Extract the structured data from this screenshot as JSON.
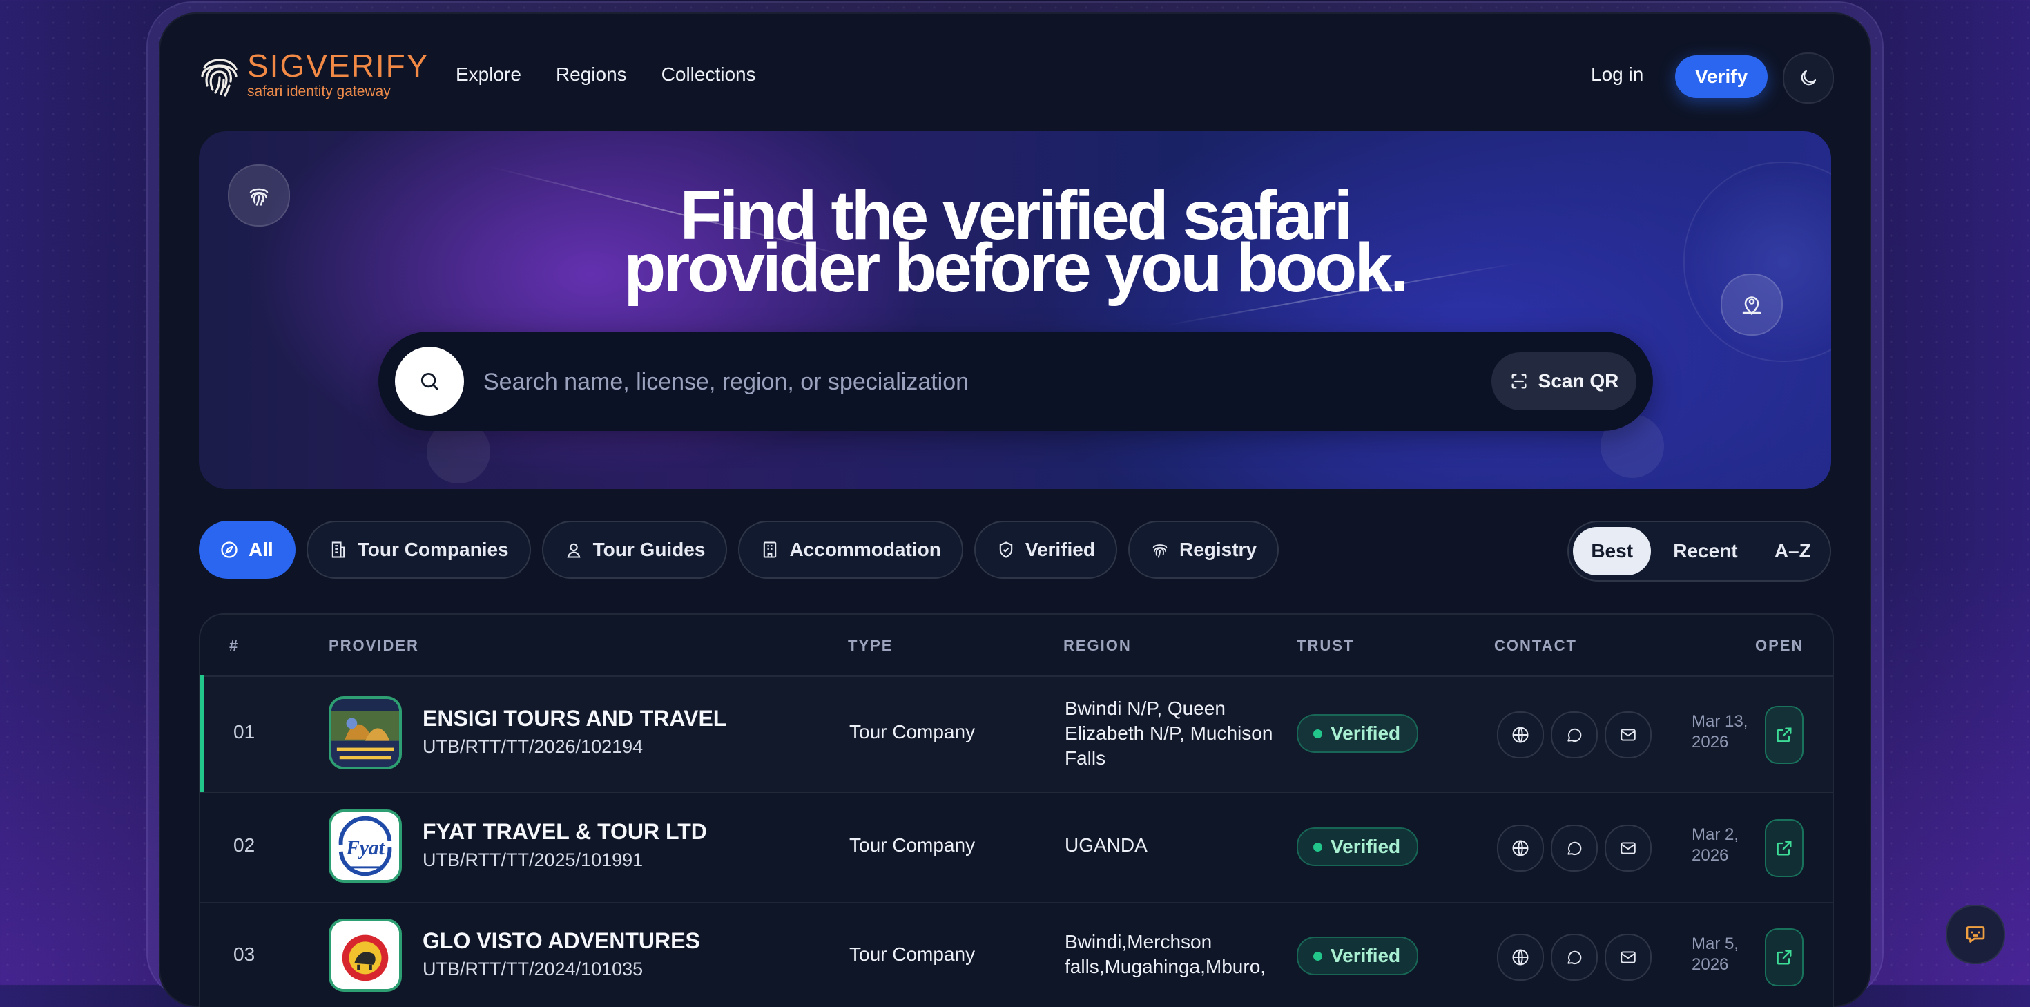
{
  "brand": {
    "name": "SIGVERIFY",
    "tagline": "safari identity gateway",
    "accent": "#f28a46"
  },
  "nav": {
    "explore": "Explore",
    "regions": "Regions",
    "collections": "Collections"
  },
  "header": {
    "login": "Log in",
    "verify": "Verify",
    "theme_icon": "moon-icon"
  },
  "hero": {
    "title_line1": "Find the verified safari",
    "title_line2": "provider before you book."
  },
  "search": {
    "placeholder": "Search name, license, region, or specialization",
    "value": "",
    "scan_label": "Scan QR"
  },
  "filters": {
    "all": "All",
    "tour_companies": "Tour Companies",
    "tour_guides": "Tour Guides",
    "accommodation": "Accommodation",
    "verified": "Verified",
    "registry": "Registry",
    "active": "All"
  },
  "sort": {
    "best": "Best",
    "recent": "Recent",
    "az": "A–Z",
    "selected": "Best"
  },
  "table": {
    "headers": {
      "num": "#",
      "provider": "PROVIDER",
      "type": "TYPE",
      "region": "REGION",
      "trust": "TRUST",
      "contact": "CONTACT",
      "open": "OPEN"
    },
    "rows": [
      {
        "rank": "01",
        "name": "ENSIGI TOURS AND TRAVEL",
        "license": "UTB/RTT/TT/2026/102194",
        "type": "Tour Company",
        "region_l1": "Bwindi N/P, Queen",
        "region_l2": "Elizabeth N/P, Muchison",
        "region_l3": "Falls",
        "trust": "Verified",
        "date_l1": "Mar 13,",
        "date_l2": "2026"
      },
      {
        "rank": "02",
        "name": "FYAT TRAVEL & TOUR LTD",
        "license": "UTB/RTT/TT/2025/101991",
        "type": "Tour Company",
        "region_l1": "UGANDA",
        "region_l2": "",
        "region_l3": "",
        "trust": "Verified",
        "date_l1": "Mar 2,",
        "date_l2": "2026",
        "logo_text": "Fyat"
      },
      {
        "rank": "03",
        "name": "GLO VISTO ADVENTURES",
        "license": "UTB/RTT/TT/2024/101035",
        "type": "Tour Company",
        "region_l1": "Bwindi,Merchson",
        "region_l2": "falls,Mugahinga,Mburo,",
        "region_l3": "",
        "trust": "Verified",
        "date_l1": "Mar 5,",
        "date_l2": "2026"
      }
    ]
  },
  "colors": {
    "primary": "#2b66f1",
    "verified": "#22c58a",
    "background": "#0e1426"
  }
}
